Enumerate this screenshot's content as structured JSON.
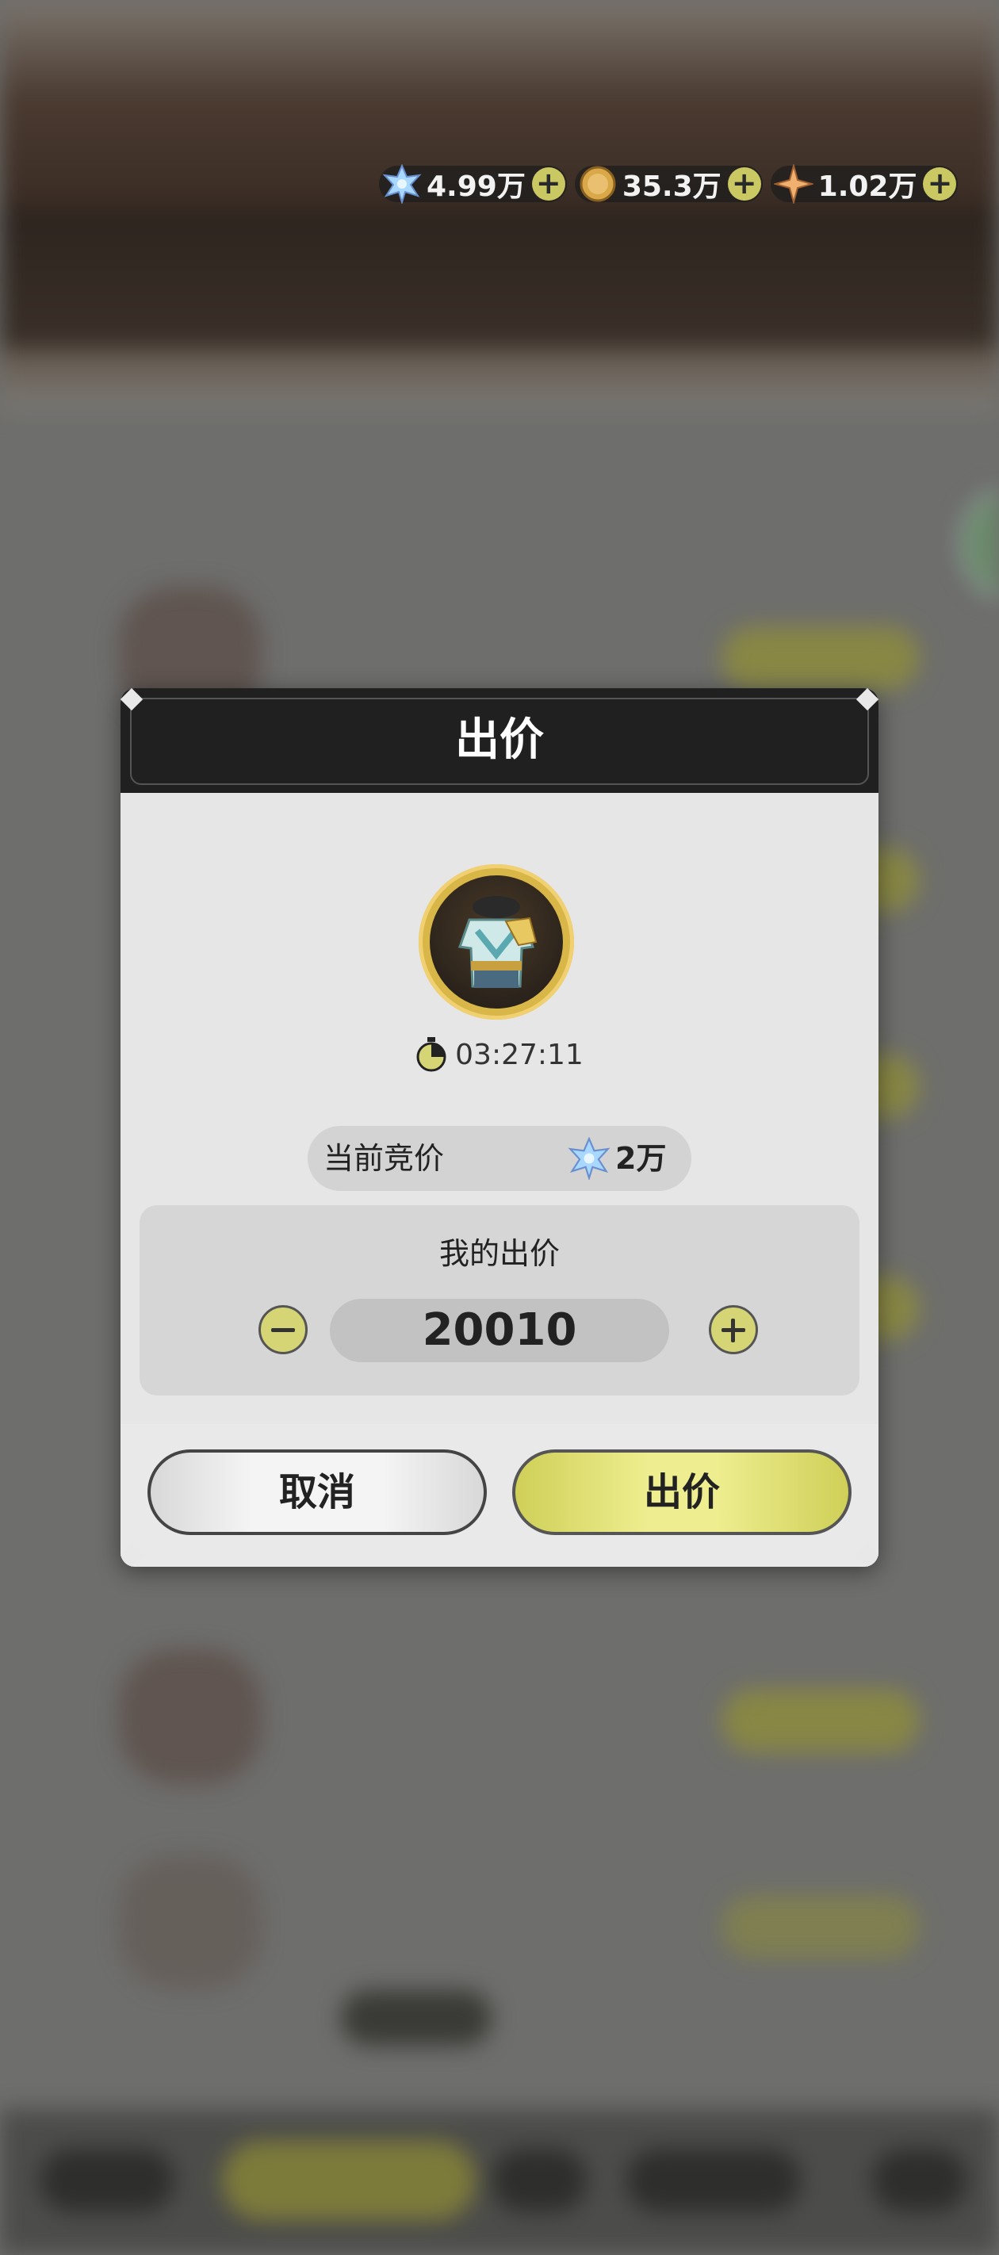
{
  "currency_bar": [
    {
      "name": "crystal",
      "value": "4.99万",
      "color": "#9fd3ff"
    },
    {
      "name": "gold-coin",
      "value": "35.3万",
      "color": "#d9a848"
    },
    {
      "name": "star-shard",
      "value": "1.02万",
      "color": "#e8a060"
    }
  ],
  "dialog": {
    "title": "出价",
    "timer": "03:27:11",
    "current_bid_label": "当前竞价",
    "current_bid_value": "2万",
    "my_bid_label": "我的出价",
    "my_bid_value": "20010",
    "cancel_label": "取消",
    "bid_label": "出价"
  },
  "colors": {
    "accent": "#d6d576",
    "panel": "#e6e6e6",
    "header": "#202020"
  }
}
